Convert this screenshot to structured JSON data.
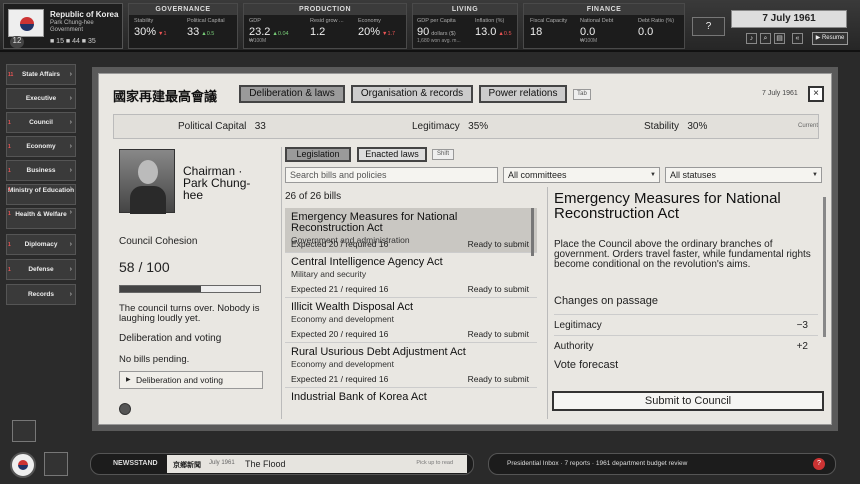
{
  "country": {
    "name": "Republic of Korea",
    "leader_line1": "Park Chung-hee",
    "leader_line2": "Government",
    "level": "12",
    "mini": "■ 15   ■ 44   ■ 35"
  },
  "governance": {
    "header": "GOVERNANCE",
    "stability_label": "Stability",
    "stability_value": "30%",
    "stability_delta": "▼1",
    "pc_label": "Political Capital",
    "pc_value": "33",
    "pc_delta": "▲0.5"
  },
  "production": {
    "header": "PRODUCTION",
    "gdp_label": "GDP",
    "gdp_value": "23.2",
    "gdp_delta": "▲0.04",
    "gdp_sub": "₩100M",
    "resid_label": "Resid grow ...",
    "resid_value": "1.2",
    "economy_label": "Economy",
    "economy_value": "20%",
    "economy_delta": "▼1.7"
  },
  "living": {
    "header": "LIVING",
    "gdppc_label": "GDP per Capita",
    "gdppc_value": "90",
    "gdppc_unit": "dollars ($)",
    "gdppc_sub": "1,680 won avg. m...",
    "inflation_label": "Inflation (%)",
    "inflation_value": "13.0",
    "inflation_delta": "▲0.5"
  },
  "finance": {
    "header": "FINANCE",
    "fc_label": "Fiscal Capacity",
    "fc_value": "18",
    "nd_label": "National Debt",
    "nd_value": "0.0",
    "nd_sub": "₩100M",
    "dr_label": "Debt Ratio (%)",
    "dr_value": "0.0"
  },
  "topright": {
    "date": "7 July 1961",
    "help": "?",
    "resume": "▶ Resume"
  },
  "sidebar": [
    {
      "label": "State Affairs",
      "badge": "11"
    },
    {
      "label": "Executive",
      "badge": ""
    },
    {
      "label": "Council",
      "badge": "1"
    },
    {
      "label": "Economy",
      "badge": "1"
    },
    {
      "label": "Business",
      "badge": "1"
    },
    {
      "label": "Ministry of Education",
      "badge": "1"
    },
    {
      "label": "Health & Welfare",
      "badge": "1"
    },
    {
      "label": "Diplomacy",
      "badge": "1"
    },
    {
      "label": "Defense",
      "badge": "1"
    },
    {
      "label": "Records",
      "badge": ""
    }
  ],
  "dialog": {
    "title": "國家再建最高會議",
    "tabs": [
      "Deliberation & laws",
      "Organisation & records",
      "Power relations"
    ],
    "tab_hint": "Tab",
    "date": "7 July 1961",
    "close": "×",
    "stats": {
      "pc_label": "Political Capital",
      "pc_value": "33",
      "leg_label": "Legitimacy",
      "leg_value": "35%",
      "stab_label": "Stability",
      "stab_value": "30%",
      "current": "Current"
    }
  },
  "left": {
    "chair_name": "Chairman · Park Chung-hee",
    "cohesion_label": "Council Cohesion",
    "cohesion_value": "58 / 100",
    "cohesion_fraction": 0.58,
    "cohesion_note": "The council turns over. Nobody is laughing loudly yet.",
    "deliberation_label": "Deliberation and voting",
    "no_bills": "No bills pending.",
    "deliberation_button": "Deliberation and voting"
  },
  "center": {
    "subtabs": [
      "Legislation",
      "Enacted laws"
    ],
    "subtab_hint": "Shift",
    "search_placeholder": "Search bills and policies",
    "committee_filter": "All committees",
    "status_filter": "All statuses",
    "count": "26 of 26 bills",
    "bills": [
      {
        "title": "Emergency Measures for National Reconstruction Act",
        "category": "Government and administration",
        "expected": "Expected 20 / required 16",
        "status": "Ready to submit"
      },
      {
        "title": "Central Intelligence Agency Act",
        "category": "Military and security",
        "expected": "Expected 21 / required 16",
        "status": "Ready to submit"
      },
      {
        "title": "Illicit Wealth Disposal Act",
        "category": "Economy and development",
        "expected": "Expected 20 / required 16",
        "status": "Ready to submit"
      },
      {
        "title": "Rural Usurious Debt Adjustment Act",
        "category": "Economy and development",
        "expected": "Expected 21 / required 16",
        "status": "Ready to submit"
      },
      {
        "title": "Industrial Bank of Korea Act",
        "category": "",
        "expected": "",
        "status": ""
      }
    ]
  },
  "detail": {
    "title": "Emergency Measures for National Reconstruction Act",
    "description": "Place the Council above the ordinary branches of government. Orders travel faster, while fundamental rights become conditional on the revolution's aims.",
    "changes_label": "Changes on passage",
    "changes": [
      {
        "label": "Legitimacy",
        "value": "−3"
      },
      {
        "label": "Authority",
        "value": "+2"
      }
    ],
    "vote_label": "Vote forecast",
    "submit": "Submit to Council"
  },
  "bottom": {
    "newsstand_label": "NEWSSTAND",
    "paper_name": "京鄉新聞",
    "paper_date": "July 1961",
    "headline": "The Flood",
    "pickup": "Pick up to read",
    "inbox": "Presidential Inbox · 7 reports · 1961 department budget review",
    "inbox_badge": "?"
  }
}
